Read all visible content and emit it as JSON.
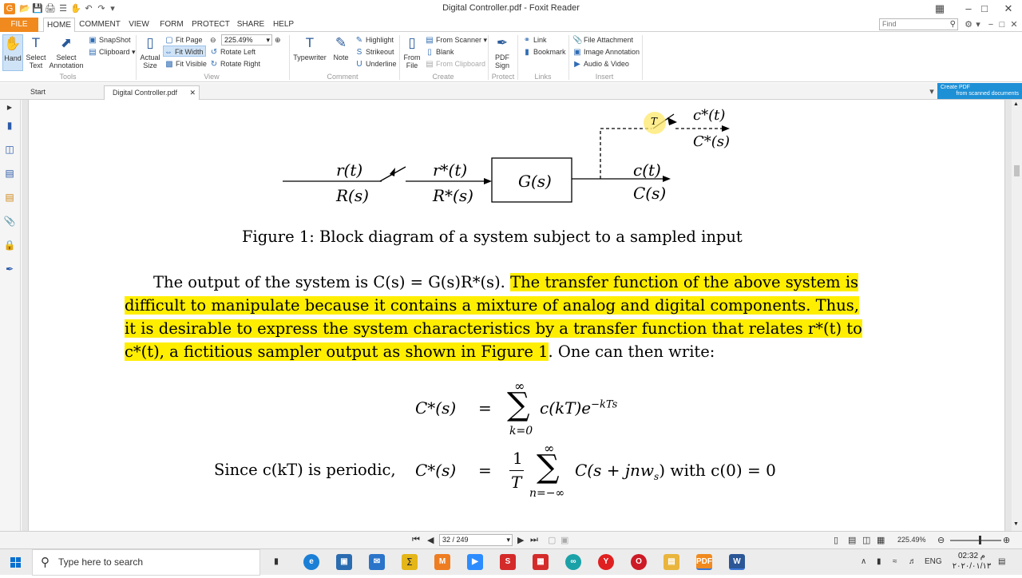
{
  "window": {
    "title": "Digital Controller.pdf - Foxit Reader"
  },
  "menu": {
    "tabs": [
      "FILE",
      "HOME",
      "COMMENT",
      "VIEW",
      "FORM",
      "PROTECT",
      "SHARE",
      "HELP"
    ],
    "find_placeholder": "Find"
  },
  "ribbon": {
    "tools": {
      "hand": "Hand",
      "select_text": "Select Text",
      "select_annotation": "Select Annotation",
      "snapshot": "SnapShot",
      "clipboard": "Clipboard",
      "label": "Tools"
    },
    "view": {
      "actual_size": "Actual Size",
      "fit_page": "Fit Page",
      "fit_width": "Fit Width",
      "fit_visible": "Fit Visible",
      "zoom": "225.49%",
      "rotate_left": "Rotate Left",
      "rotate_right": "Rotate Right",
      "label": "View"
    },
    "comment": {
      "typewriter": "Typewriter",
      "note": "Note",
      "highlight": "Highlight",
      "strikeout": "Strikeout",
      "underline": "Underline",
      "label": "Comment"
    },
    "create": {
      "from_file": "From File",
      "from_scanner": "From Scanner",
      "blank": "Blank",
      "from_clipboard": "From Clipboard",
      "label": "Create"
    },
    "protect": {
      "pdf_sign": "PDF Sign",
      "label": "Protect"
    },
    "links": {
      "link": "Link",
      "bookmark": "Bookmark",
      "label": "Links"
    },
    "insert": {
      "file_attachment": "File Attachment",
      "image_annotation": "Image Annotation",
      "audio_video": "Audio & Video",
      "label": "Insert"
    }
  },
  "doc_tabs": {
    "start": "Start",
    "current": "Digital Controller.pdf"
  },
  "ad": {
    "line1": "Create PDF",
    "line2": "from scanned documents"
  },
  "document": {
    "diagram": {
      "r_t": "r(t)",
      "R_s": "R(s)",
      "rstar_t": "r*(t)",
      "Rstar_s": "R*(s)",
      "G_s": "G(s)",
      "c_t": "c(t)",
      "C_s": "C(s)",
      "cstar_t": "c*(t)",
      "Cstar_s": "C*(s)",
      "T_label": "T"
    },
    "caption": "Figure 1:  Block diagram of a system subject to a sampled input",
    "para_line1_plain": "The output of the system is C(s) = G(s)R*(s). ",
    "para_line1_hl": "The transfer function of the above system is",
    "para_line2_hl": "difficult to manipulate because it contains a mixture of analog and digital components.  Thus,",
    "para_line3_hl": "it is desirable to express the system characteristics by a transfer function that relates r*(t) to",
    "para_line4_hl": "c*(t), a fictitious sampler output as shown in Figure 1",
    "para_line4_plain": ". One can then write:",
    "eq1_lhs": "C*(s)",
    "eq1_rhs": "c(kT)e",
    "eq1_exp": "−kTs",
    "eq1_sum_top": "∞",
    "eq1_sum_bottom": "k=0",
    "eq2_prefix": "Since c(kT) is periodic,",
    "eq2_lhs": "C*(s)",
    "eq2_frac_num": "1",
    "eq2_frac_den": "T",
    "eq2_sum_top": "∞",
    "eq2_sum_bottom": "n=−∞",
    "eq2_rhs": "C(s + jnw",
    "eq2_rhs_sub": "s",
    "eq2_rhs_end": ")  with c(0) = 0",
    "equals": "="
  },
  "status": {
    "page": "32 / 249",
    "zoom": "225.49%"
  },
  "taskbar": {
    "search_placeholder": "Type here to search",
    "lang": "ENG",
    "time": "02:32 م",
    "date": "٢٠٢٠/٠١/١٣"
  }
}
